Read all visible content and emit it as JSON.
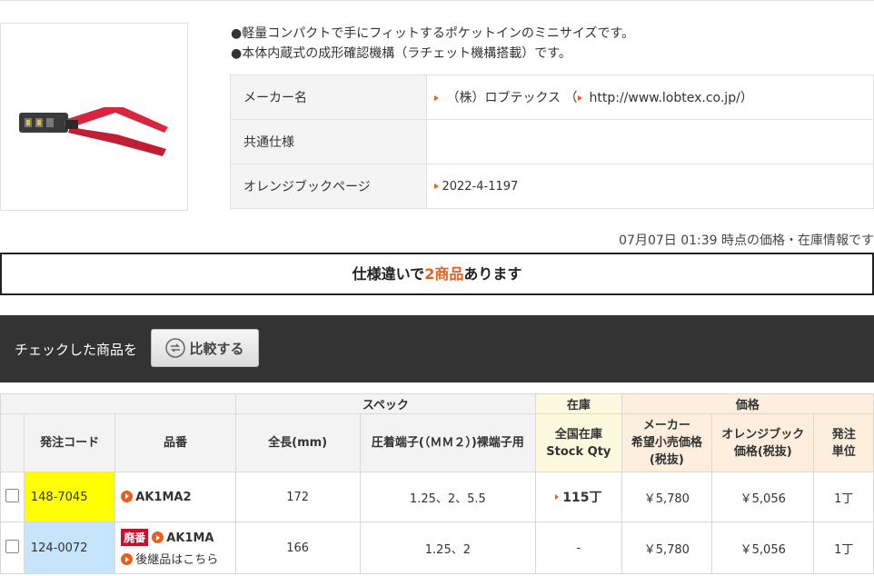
{
  "features": [
    "●軽量コンパクトで手にフィットするポケットインのミニサイズです。",
    "●本体内蔵式の成形確認機構（ラチェット機構搭載）です。"
  ],
  "info": {
    "maker_label": "メーカー名",
    "maker_value": "（株）ロブテックス",
    "maker_url_open": "（",
    "maker_url": "http://www.lobtex.co.jp/",
    "maker_url_close": "）",
    "common_spec_label": "共通仕様",
    "orange_book_label": "オレンジブックページ",
    "orange_book_value": "2022-4-1197"
  },
  "timestamp": "07月07日 01:39 時点の価格・在庫情報です",
  "variant_banner": {
    "prefix": "仕様違いで",
    "highlight": "2商品",
    "suffix": "あります"
  },
  "compare": {
    "label": "チェックした商品を",
    "button": "比較する"
  },
  "table": {
    "groups": {
      "spec": "スペック",
      "stock": "在庫",
      "price": "価格"
    },
    "headers": {
      "order_code": "発注コード",
      "part_no": "品番",
      "length": "全長(mm)",
      "terminal": "圧着端子(（ＭＭ２）)裸端子用",
      "stock_line1": "全国在庫",
      "stock_line2": "Stock Qty",
      "maker_price_line1": "メーカー",
      "maker_price_line2": "希望小売価格",
      "maker_price_line3": "(税抜)",
      "ob_price_line1": "オレンジブック",
      "ob_price_line2": "価格(税抜)",
      "unit_line1": "発注",
      "unit_line2": "単位"
    },
    "rows": [
      {
        "order_code": "148-7045",
        "part_no": "AK1MA2",
        "length": "172",
        "terminal": "1.25、2、5.5",
        "stock": "115丁",
        "maker_price": "￥5,780",
        "ob_price": "￥5,056",
        "unit": "1丁"
      },
      {
        "order_code": "124-0072",
        "badge": "廃番",
        "part_no": "AK1MA",
        "successor": "後継品はこちら",
        "length": "166",
        "terminal": "1.25、2",
        "stock": "-",
        "maker_price": "￥5,780",
        "ob_price": "￥5,056",
        "unit": "1丁"
      }
    ]
  },
  "colors": {
    "accent": "#e8601c",
    "highlight_yellow": "#ffff00",
    "highlight_blue": "#c6e4fb",
    "discontinued_red": "#c8102e",
    "compare_bar": "#333333"
  }
}
